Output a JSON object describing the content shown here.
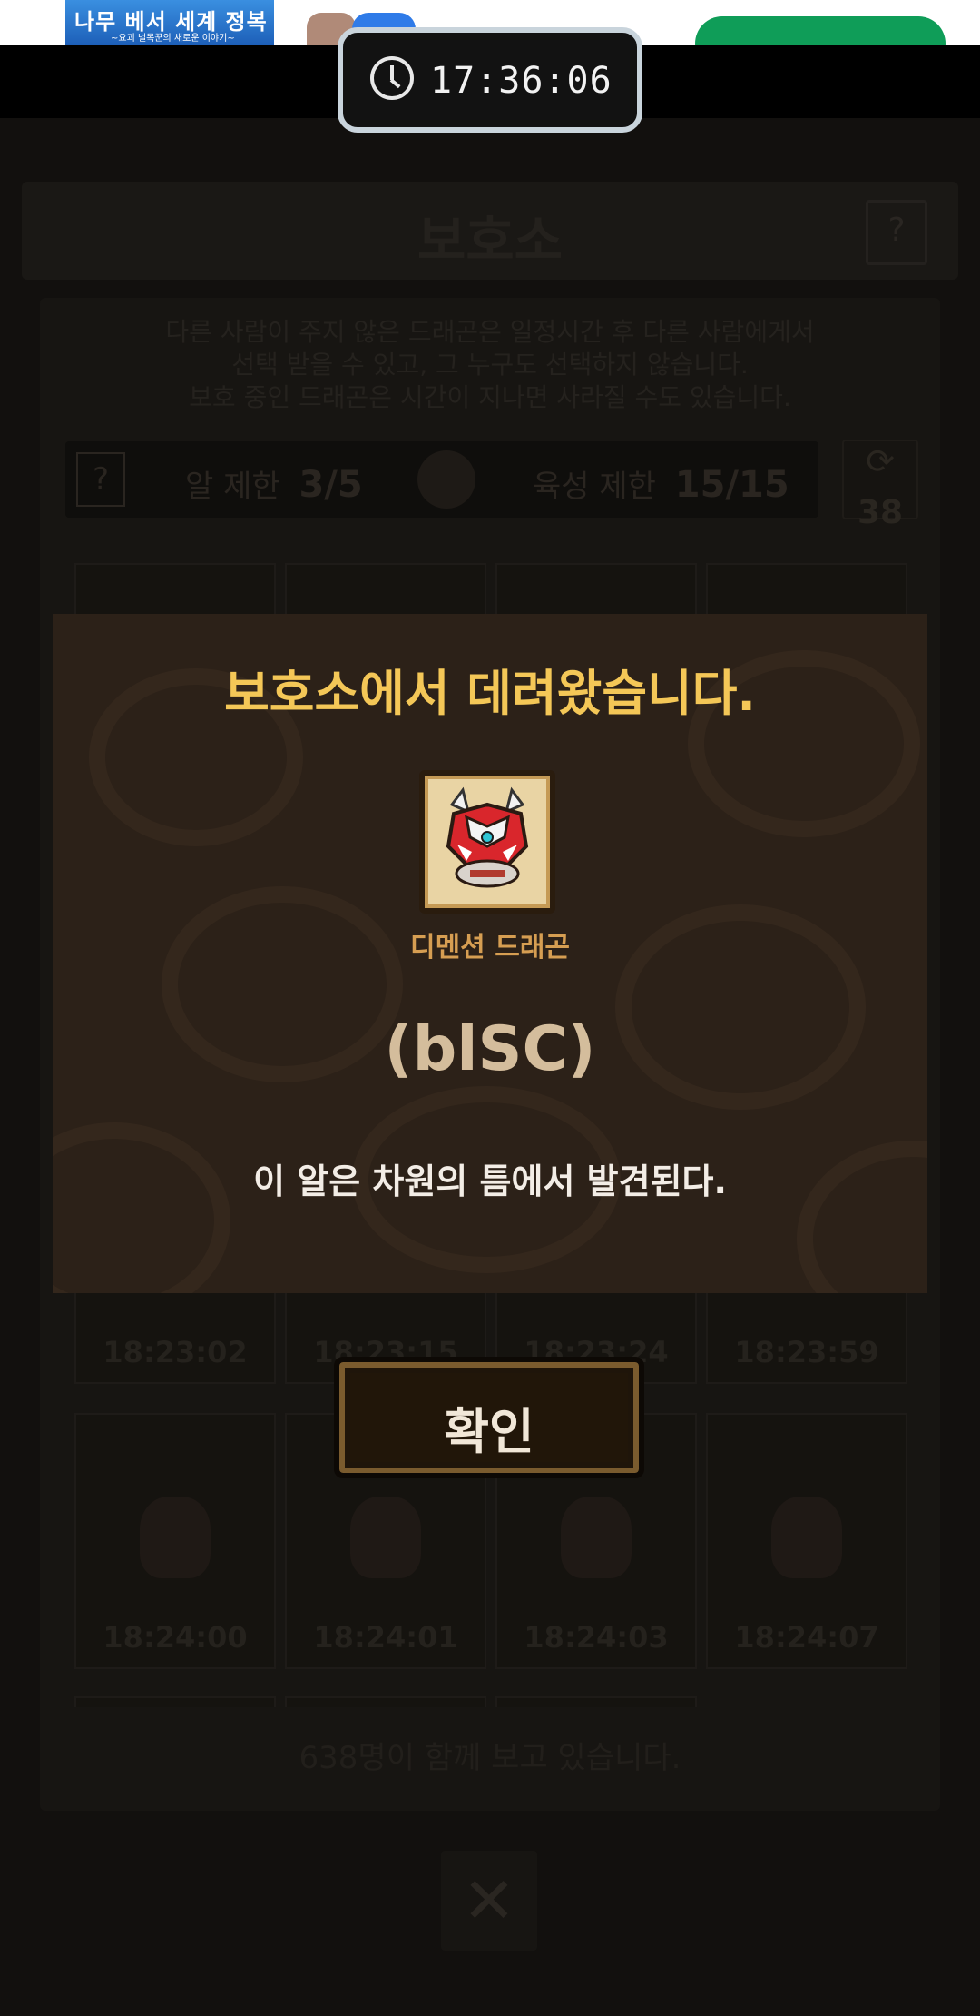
{
  "ad": {
    "banner_title": "나무 베서 세계 정복",
    "banner_subtitle": "~요괴 벌목꾼의 새로운 이야기~"
  },
  "timer": {
    "time": "17:36:06",
    "icon": "clock-icon"
  },
  "background": {
    "title": "보호소",
    "help_label": "?",
    "description_lines": [
      "다른 사람이 주지 않은 드래곤은 일정시간 후 다른 사람에게서",
      "선택 받을 수 있고, 그 누구도 선택하지 않습니다.",
      "보호 중인 드래곤은 시간이 지나면 사라질 수도 있습니다."
    ],
    "egg_limit_label": "알 제한",
    "egg_limit_value": "3/5",
    "raise_limit_label": "육성 제한",
    "raise_limit_value": "15/15",
    "refresh_count": "38",
    "row1_times": [
      "18:23:02",
      "18:23:15",
      "18:23:24",
      "18:23:59"
    ],
    "row2_times": [
      "18:24:00",
      "18:24:01",
      "18:24:03",
      "18:24:07"
    ],
    "footer_text": "638명이 함께 보고 있습니다.",
    "close_label": "✕"
  },
  "modal": {
    "title": "보호소에서 데려왔습니다.",
    "dragon_name": "디멘션 드래곤",
    "egg_code": "(blSC)",
    "description": "이 알은 차원의 틈에서 발견된다.",
    "dragon_icon": "dimension-dragon-icon"
  },
  "confirm_button": {
    "label": "확인"
  },
  "colors": {
    "modal_title": "#f4c757",
    "dragon_name": "#d69e52",
    "egg_code": "#d4bd9c",
    "modal_bg": "#2c2118"
  }
}
